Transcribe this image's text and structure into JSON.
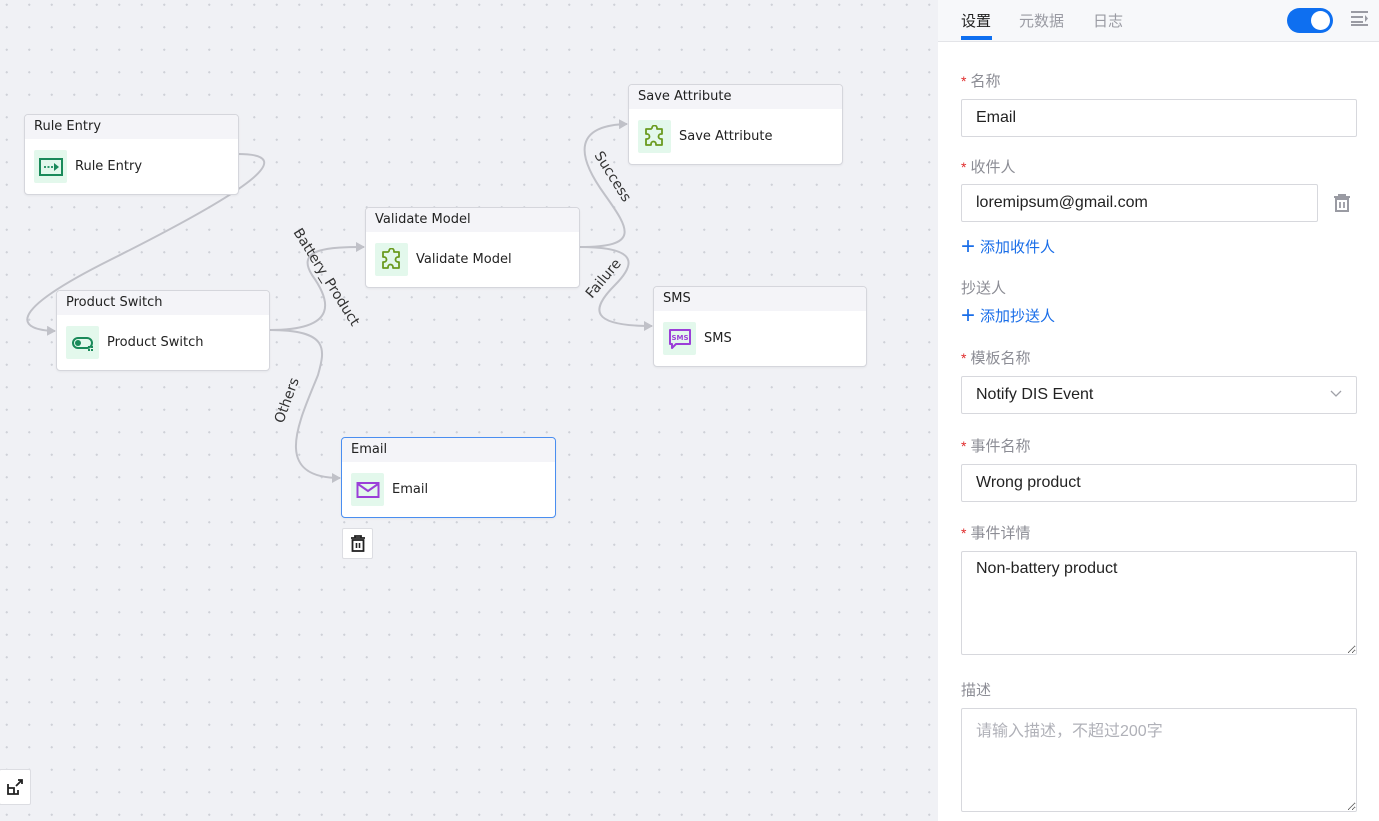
{
  "canvas": {
    "nodes": {
      "rule_entry": {
        "title": "Rule Entry",
        "label": "Rule Entry",
        "icon": "rule-entry-icon"
      },
      "product_switch": {
        "title": "Product Switch",
        "label": "Product Switch",
        "icon": "switch-icon"
      },
      "validate_model": {
        "title": "Validate Model",
        "label": "Validate Model",
        "icon": "puzzle-icon"
      },
      "save_attribute": {
        "title": "Save Attribute",
        "label": "Save Attribute",
        "icon": "puzzle-icon"
      },
      "sms": {
        "title": "SMS",
        "label": "SMS",
        "icon": "sms-icon"
      },
      "email": {
        "title": "Email",
        "label": "Email",
        "icon": "mail-icon",
        "selected": true
      }
    },
    "edges": [
      {
        "from": "Rule Entry",
        "to": "Product Switch",
        "label": ""
      },
      {
        "from": "Product Switch",
        "to": "Validate Model",
        "label": "Battery_Product"
      },
      {
        "from": "Product Switch",
        "to": "Email",
        "label": "Others"
      },
      {
        "from": "Validate Model",
        "to": "Save Attribute",
        "label": "Success"
      },
      {
        "from": "Validate Model",
        "to": "SMS",
        "label": "Failure"
      }
    ]
  },
  "panel": {
    "tabs": [
      {
        "label": "设置",
        "active": true
      },
      {
        "label": "元数据",
        "active": false
      },
      {
        "label": "日志",
        "active": false
      }
    ],
    "toggle_on": true,
    "fields": {
      "name": {
        "label": "名称",
        "required": "*",
        "value": "Email"
      },
      "recipient": {
        "label": "收件人",
        "required": "*",
        "value": "loremipsum@gmail.com"
      },
      "add_recipient": "添加收件人",
      "cc": {
        "label": "抄送人"
      },
      "add_cc": "添加抄送人",
      "template": {
        "label": "模板名称",
        "required": "*",
        "value": "Notify DIS Event"
      },
      "event_name": {
        "label": "事件名称",
        "required": "*",
        "value": "Wrong product"
      },
      "event_detail": {
        "label": "事件详情",
        "required": "*",
        "value": "Non-battery product"
      },
      "description": {
        "label": "描述",
        "placeholder": "请输入描述，不超过200字",
        "value": ""
      }
    },
    "plus_glyph": "+"
  },
  "colors": {
    "accent": "#0e6ff0",
    "required": "#e02b2b",
    "link": "#1a6ee8",
    "icon_green": "#1a8a5a",
    "icon_olive": "#6a9a1f",
    "icon_purple": "#9b3fd8"
  }
}
